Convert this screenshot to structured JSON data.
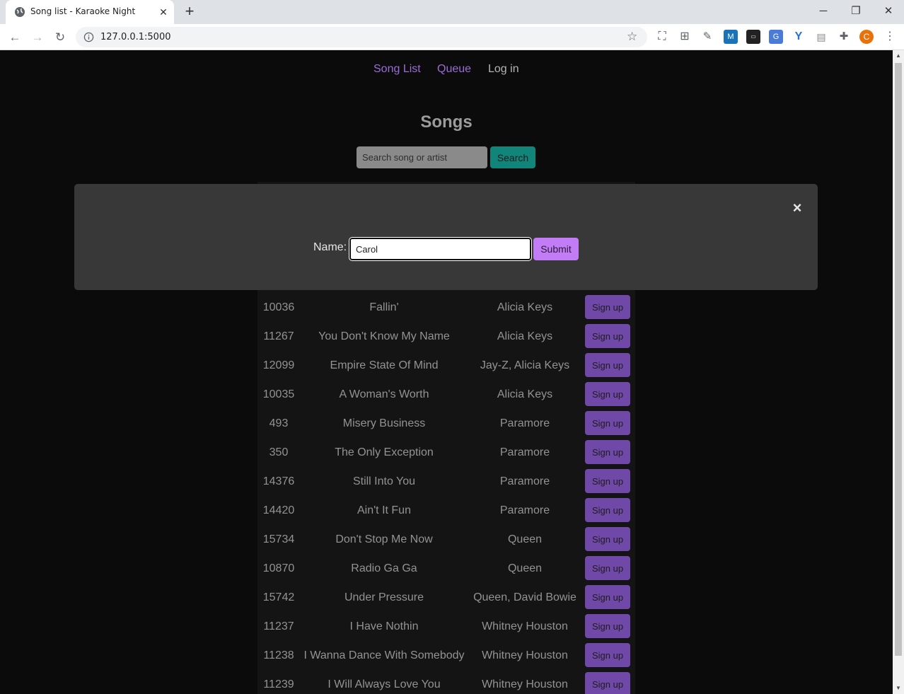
{
  "browser": {
    "tab_title": "Song list - Karaoke Night",
    "url": "127.0.0.1:5000",
    "profile_initial": "C"
  },
  "nav": {
    "song_list": "Song List",
    "queue": "Queue",
    "login": "Log in"
  },
  "page_title": "Songs",
  "search": {
    "placeholder": "Search song or artist",
    "button": "Search"
  },
  "modal": {
    "label": "Name:",
    "value": "Carol",
    "submit": "Submit",
    "close": "×"
  },
  "signup_label": "Sign up",
  "songs": [
    {
      "id": "10036",
      "title": "Fallin'",
      "artist": "Alicia Keys"
    },
    {
      "id": "11267",
      "title": "You Don't Know My Name",
      "artist": "Alicia Keys"
    },
    {
      "id": "12099",
      "title": "Empire State Of Mind",
      "artist": "Jay-Z, Alicia Keys"
    },
    {
      "id": "10035",
      "title": "A Woman's Worth",
      "artist": "Alicia Keys"
    },
    {
      "id": "493",
      "title": "Misery Business",
      "artist": "Paramore"
    },
    {
      "id": "350",
      "title": "The Only Exception",
      "artist": "Paramore"
    },
    {
      "id": "14376",
      "title": "Still Into You",
      "artist": "Paramore"
    },
    {
      "id": "14420",
      "title": "Ain't It Fun",
      "artist": "Paramore"
    },
    {
      "id": "15734",
      "title": "Don't Stop Me Now",
      "artist": "Queen"
    },
    {
      "id": "10870",
      "title": "Radio Ga Ga",
      "artist": "Queen"
    },
    {
      "id": "15742",
      "title": "Under Pressure",
      "artist": "Queen, David Bowie"
    },
    {
      "id": "11237",
      "title": "I Have Nothin",
      "artist": "Whitney Houston"
    },
    {
      "id": "11238",
      "title": "I Wanna Dance With Somebody",
      "artist": "Whitney Houston"
    },
    {
      "id": "11239",
      "title": "I Will Always Love You",
      "artist": "Whitney Houston"
    }
  ]
}
